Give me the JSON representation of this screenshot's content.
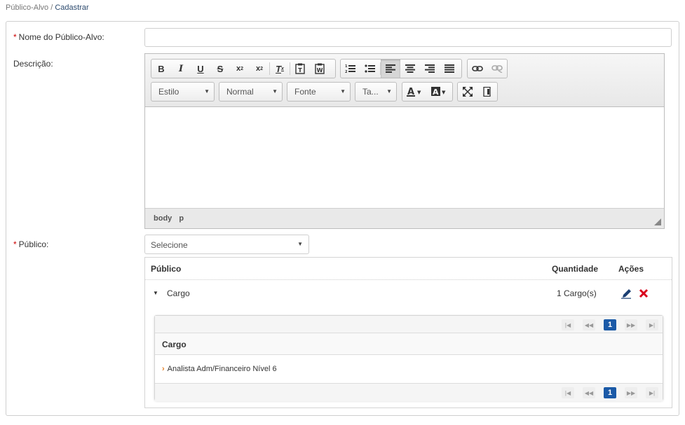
{
  "breadcrumb": {
    "parent": "Público-Alvo",
    "separator": "/",
    "current": "Cadastrar"
  },
  "form": {
    "required_mark": "*",
    "name_label": "Nome do Público-Alvo:",
    "name_value": "",
    "description_label": "Descrição:",
    "public_label": "Público:",
    "public_select_value": "Selecione"
  },
  "editor": {
    "combos": {
      "style": "Estilo",
      "format": "Normal",
      "font": "Fonte",
      "size": "Ta..."
    },
    "status_path": [
      "body",
      "p"
    ],
    "content": ""
  },
  "table": {
    "headers": {
      "public": "Público",
      "quantity": "Quantidade",
      "actions": "Ações"
    },
    "rows": [
      {
        "name": "Cargo",
        "quantity": "1 Cargo(s)"
      }
    ]
  },
  "subtable": {
    "header": "Cargo",
    "items": [
      "Analista Adm/Financeiro Nível 6"
    ],
    "current_page": "1"
  },
  "colors": {
    "accent": "#1b5aa7",
    "required": "#cc0000",
    "delete": "#d9001b",
    "chevron": "#e67e22"
  }
}
